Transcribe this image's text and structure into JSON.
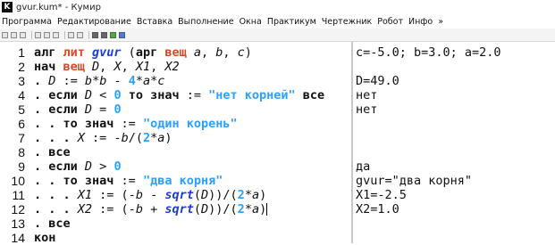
{
  "window": {
    "title": "gvur.kum* - Кумир",
    "app_icon_letter": "K"
  },
  "menu": [
    "Программа",
    "Редактирование",
    "Вставка",
    "Выполнение",
    "Окна",
    "Практикум",
    "Чертежник",
    "Робот",
    "Инфо",
    "»"
  ],
  "toolbar": {
    "icons": [
      "new-icon",
      "open-icon",
      "save-icon",
      "cut-icon",
      "copy-icon",
      "paste-icon",
      "undo-icon",
      "redo-icon",
      "run-icon",
      "step-icon",
      "stop-icon",
      "grid-icon"
    ]
  },
  "code_lines": [
    {
      "num": "1",
      "tokens": [
        {
          "t": "алг ",
          "c": "kw"
        },
        {
          "t": "лит ",
          "c": "tyred"
        },
        {
          "t": "gvur",
          "c": "fn"
        },
        {
          "t": " (",
          "c": "op"
        },
        {
          "t": "арг ",
          "c": "kw"
        },
        {
          "t": "вещ ",
          "c": "tyred"
        },
        {
          "t": "a",
          "c": "var"
        },
        {
          "t": ", ",
          "c": "op"
        },
        {
          "t": "b",
          "c": "var"
        },
        {
          "t": ", ",
          "c": "op"
        },
        {
          "t": "c",
          "c": "var"
        },
        {
          "t": ")",
          "c": "op"
        }
      ]
    },
    {
      "num": "2",
      "tokens": [
        {
          "t": "нач ",
          "c": "kw"
        },
        {
          "t": "вещ ",
          "c": "tyred"
        },
        {
          "t": "D",
          "c": "var"
        },
        {
          "t": ", ",
          "c": "op"
        },
        {
          "t": "X",
          "c": "var"
        },
        {
          "t": ", ",
          "c": "op"
        },
        {
          "t": "X1",
          "c": "var"
        },
        {
          "t": ", ",
          "c": "op"
        },
        {
          "t": "X2",
          "c": "var"
        }
      ]
    },
    {
      "num": "3",
      "tokens": [
        {
          "t": ". ",
          "c": "kw"
        },
        {
          "t": "D",
          "c": "var"
        },
        {
          "t": " := ",
          "c": "op"
        },
        {
          "t": "b",
          "c": "var"
        },
        {
          "t": "*",
          "c": "op"
        },
        {
          "t": "b",
          "c": "var"
        },
        {
          "t": " - ",
          "c": "op"
        },
        {
          "t": "4",
          "c": "num"
        },
        {
          "t": "*",
          "c": "op"
        },
        {
          "t": "a",
          "c": "var"
        },
        {
          "t": "*",
          "c": "op"
        },
        {
          "t": "c",
          "c": "var"
        }
      ]
    },
    {
      "num": "4",
      "tokens": [
        {
          "t": ". если ",
          "c": "kw"
        },
        {
          "t": "D",
          "c": "var"
        },
        {
          "t": " < ",
          "c": "op"
        },
        {
          "t": "0",
          "c": "num"
        },
        {
          "t": " то ",
          "c": "kw"
        },
        {
          "t": "знач",
          "c": "kw"
        },
        {
          "t": " := ",
          "c": "op"
        },
        {
          "t": "\"нет корней\"",
          "c": "str"
        },
        {
          "t": " все",
          "c": "kw"
        }
      ]
    },
    {
      "num": "5",
      "tokens": [
        {
          "t": ". если ",
          "c": "kw"
        },
        {
          "t": "D",
          "c": "var"
        },
        {
          "t": " = ",
          "c": "op"
        },
        {
          "t": "0",
          "c": "num"
        }
      ]
    },
    {
      "num": "6",
      "tokens": [
        {
          "t": ". . то ",
          "c": "kw"
        },
        {
          "t": "знач",
          "c": "kw"
        },
        {
          "t": " := ",
          "c": "op"
        },
        {
          "t": "\"один корень\"",
          "c": "str"
        }
      ]
    },
    {
      "num": "7",
      "tokens": [
        {
          "t": ". . . ",
          "c": "kw"
        },
        {
          "t": "X",
          "c": "var"
        },
        {
          "t": " := -",
          "c": "op"
        },
        {
          "t": "b",
          "c": "var"
        },
        {
          "t": "/(",
          "c": "op"
        },
        {
          "t": "2",
          "c": "num"
        },
        {
          "t": "*",
          "c": "op"
        },
        {
          "t": "a",
          "c": "var"
        },
        {
          "t": ")",
          "c": "op"
        }
      ]
    },
    {
      "num": "8",
      "tokens": [
        {
          "t": ". все",
          "c": "kw"
        }
      ]
    },
    {
      "num": "9",
      "tokens": [
        {
          "t": ". если ",
          "c": "kw"
        },
        {
          "t": "D",
          "c": "var"
        },
        {
          "t": " > ",
          "c": "op"
        },
        {
          "t": "0",
          "c": "num"
        }
      ]
    },
    {
      "num": "10",
      "tokens": [
        {
          "t": ". . то ",
          "c": "kw"
        },
        {
          "t": "знач",
          "c": "kw"
        },
        {
          "t": " := ",
          "c": "op"
        },
        {
          "t": "\"два корня\"",
          "c": "str"
        }
      ]
    },
    {
      "num": "11",
      "tokens": [
        {
          "t": ". . . ",
          "c": "kw"
        },
        {
          "t": "X1",
          "c": "var"
        },
        {
          "t": " := (-",
          "c": "op"
        },
        {
          "t": "b",
          "c": "var"
        },
        {
          "t": " - ",
          "c": "op"
        },
        {
          "t": "sqrt",
          "c": "fn"
        },
        {
          "t": "(",
          "c": "op"
        },
        {
          "t": "D",
          "c": "var"
        },
        {
          "t": "))/(",
          "c": "op"
        },
        {
          "t": "2",
          "c": "num"
        },
        {
          "t": "*",
          "c": "op"
        },
        {
          "t": "a",
          "c": "var"
        },
        {
          "t": ")",
          "c": "op"
        }
      ]
    },
    {
      "num": "12",
      "tokens": [
        {
          "t": ". . . ",
          "c": "kw"
        },
        {
          "t": "X2",
          "c": "var"
        },
        {
          "t": " := (-",
          "c": "op"
        },
        {
          "t": "b",
          "c": "var"
        },
        {
          "t": " + ",
          "c": "op"
        },
        {
          "t": "sqrt",
          "c": "fn"
        },
        {
          "t": "(",
          "c": "op"
        },
        {
          "t": "D",
          "c": "var"
        },
        {
          "t": "))/(",
          "c": "op"
        },
        {
          "t": "2",
          "c": "num"
        },
        {
          "t": "*",
          "c": "op"
        },
        {
          "t": "a",
          "c": "var"
        },
        {
          "t": ")",
          "c": "op"
        }
      ]
    },
    {
      "num": "13",
      "tokens": [
        {
          "t": ". все",
          "c": "kw"
        }
      ]
    },
    {
      "num": "14",
      "tokens": [
        {
          "t": "кон",
          "c": "kw"
        }
      ]
    }
  ],
  "cursor_line": 12,
  "output_lines": [
    "c=-5.0; b=3.0; a=2.0",
    "",
    "D=49.0",
    "нет",
    "нет",
    "",
    "",
    "",
    "да",
    "gvur=\"два корня\"",
    "X1=-2.5",
    "X2=1.0",
    "",
    ""
  ]
}
